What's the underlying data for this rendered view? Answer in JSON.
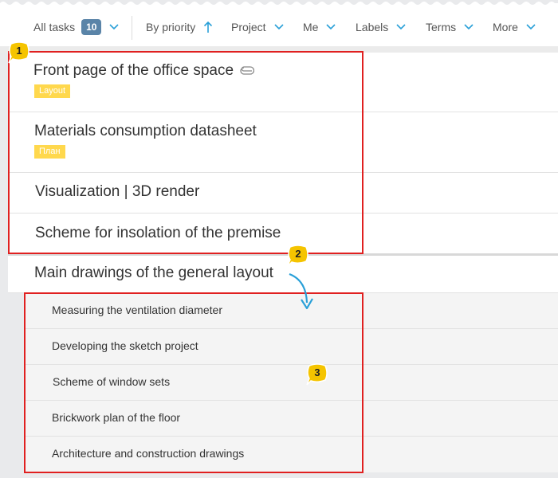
{
  "toolbar": {
    "all_tasks": "All tasks",
    "count": "10",
    "by_priority": "By priority",
    "project": "Project",
    "me": "Me",
    "labels": "Labels",
    "terms": "Terms",
    "more": "More"
  },
  "tasks": [
    {
      "title": "Front page of the office space",
      "tag": "Layout",
      "has_attachment": true
    },
    {
      "title": "Materials consumption datasheet",
      "tag": "План"
    },
    {
      "title": "Visualization | 3D render"
    },
    {
      "title": "Scheme for insolation of the premise"
    }
  ],
  "parent_task": {
    "title": "Main drawings of the general layout"
  },
  "subtasks": [
    "Measuring the ventilation diameter",
    "Developing the sketch project",
    "Scheme of window sets",
    "Brickwork plan of the floor",
    "Architecture and construction drawings"
  ],
  "markers": [
    "1",
    "2",
    "3"
  ],
  "colors": {
    "accent": "#2aa0d8",
    "tag": "#ffd84d",
    "highlight": "#e02020",
    "badge": "#5a84a8",
    "marker": "#f5c400"
  },
  "icons": {
    "sort": "arrow-up-icon",
    "dropdown": "chevron-down-icon",
    "attachment": "paperclip-icon",
    "pointer": "curved-arrow-icon"
  }
}
